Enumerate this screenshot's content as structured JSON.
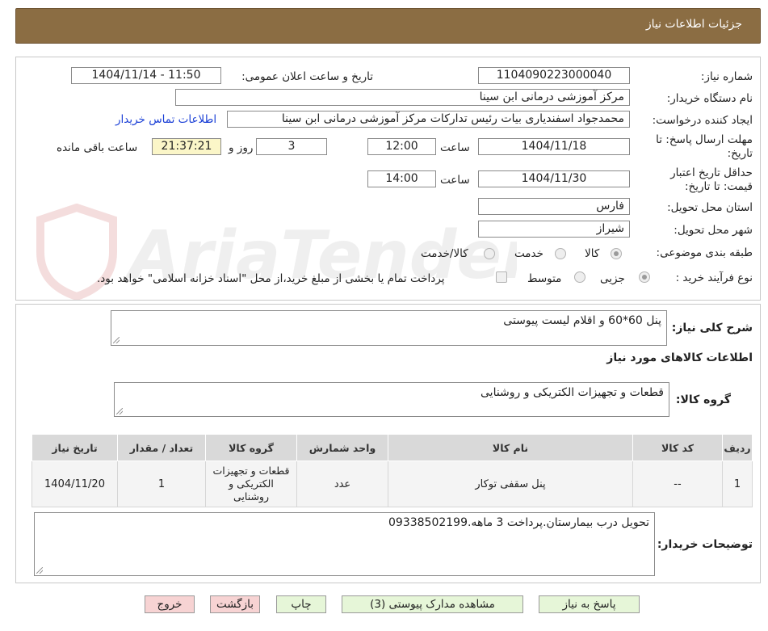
{
  "header": {
    "title": "جزئیات اطلاعات نیاز"
  },
  "watermark_text": "AriaTender.neT",
  "fields": {
    "need_number_label": "شماره نیاز:",
    "need_number": "1104090223000040",
    "announce_label": "تاریخ و ساعت اعلان عمومی:",
    "announce_value": "1404/11/14 - 11:50",
    "buyer_label": "نام دستگاه خریدار:",
    "buyer_value": "مرکز آموزشی درمانی ابن سینا",
    "creator_label": "ایجاد کننده درخواست:",
    "creator_value": "محمدجواد  اسفندیاری بیات رئیس تدارکات مرکز آموزشی درمانی ابن سینا",
    "contact_link": "اطلاعات تماس خریدار",
    "deadline_label": "مهلت ارسال پاسخ: تا تاریخ:",
    "deadline_date": "1404/11/18",
    "time_label": "ساعت",
    "deadline_time": "12:00",
    "days_value": "3",
    "days_label": "روز و",
    "remaining_time": "21:37:21",
    "remaining_label": "ساعت باقی مانده",
    "validity_label": "حداقل تاریخ اعتبار قیمت: تا تاریخ:",
    "validity_date": "1404/11/30",
    "validity_time": "14:00",
    "province_label": "استان محل تحویل:",
    "province_value": "فارس",
    "city_label": "شهر محل تحویل:",
    "city_value": "شیراز",
    "category_label": "طبقه بندی موضوعی:",
    "category_options": [
      "کالا",
      "خدمت",
      "کالا/خدمت"
    ],
    "process_label": "نوع فرآیند خرید :",
    "process_options": [
      "جزیی",
      "متوسط"
    ],
    "payment_note": "پرداخت تمام یا بخشی از مبلغ خرید،از محل \"اسناد خزانه اسلامی\" خواهد بود."
  },
  "description": {
    "label": "شرح کلی نیاز:",
    "value": "پنل 60*60 و اقلام لیست پیوستی"
  },
  "goods_info_title": "اطلاعات کالاهای مورد نیاز",
  "goods_group": {
    "label": "گروه کالا:",
    "value": "قطعات و تجهیزات الکتریکی و روشنایی"
  },
  "table": {
    "headers": [
      "ردیف",
      "کد کالا",
      "نام کالا",
      "واحد شمارش",
      "گروه کالا",
      "تعداد / مقدار",
      "تاریخ نیاز"
    ],
    "rows": [
      [
        "1",
        "--",
        "پنل سقفی توکار",
        "عدد",
        "قطعات و تجهیزات الکتریکی و روشنایی",
        "1",
        "1404/11/20"
      ]
    ]
  },
  "buyer_notes": {
    "label": "توضیحات خریدار:",
    "value": "تحویل درب بیمارستان.پرداخت 3 ماهه.09338502199"
  },
  "buttons": {
    "reply": "پاسخ به نیاز",
    "attachments": "مشاهده مدارک پیوستی (3)",
    "print": "چاپ",
    "back": "بازگشت",
    "exit": "خروج"
  },
  "colors": {
    "header_bg": "#8b6d43",
    "link": "#1a3fd6",
    "btn_green": "#e6f6d8",
    "btn_pink": "#f7d3d3",
    "highlight": "#fbf6c8"
  }
}
